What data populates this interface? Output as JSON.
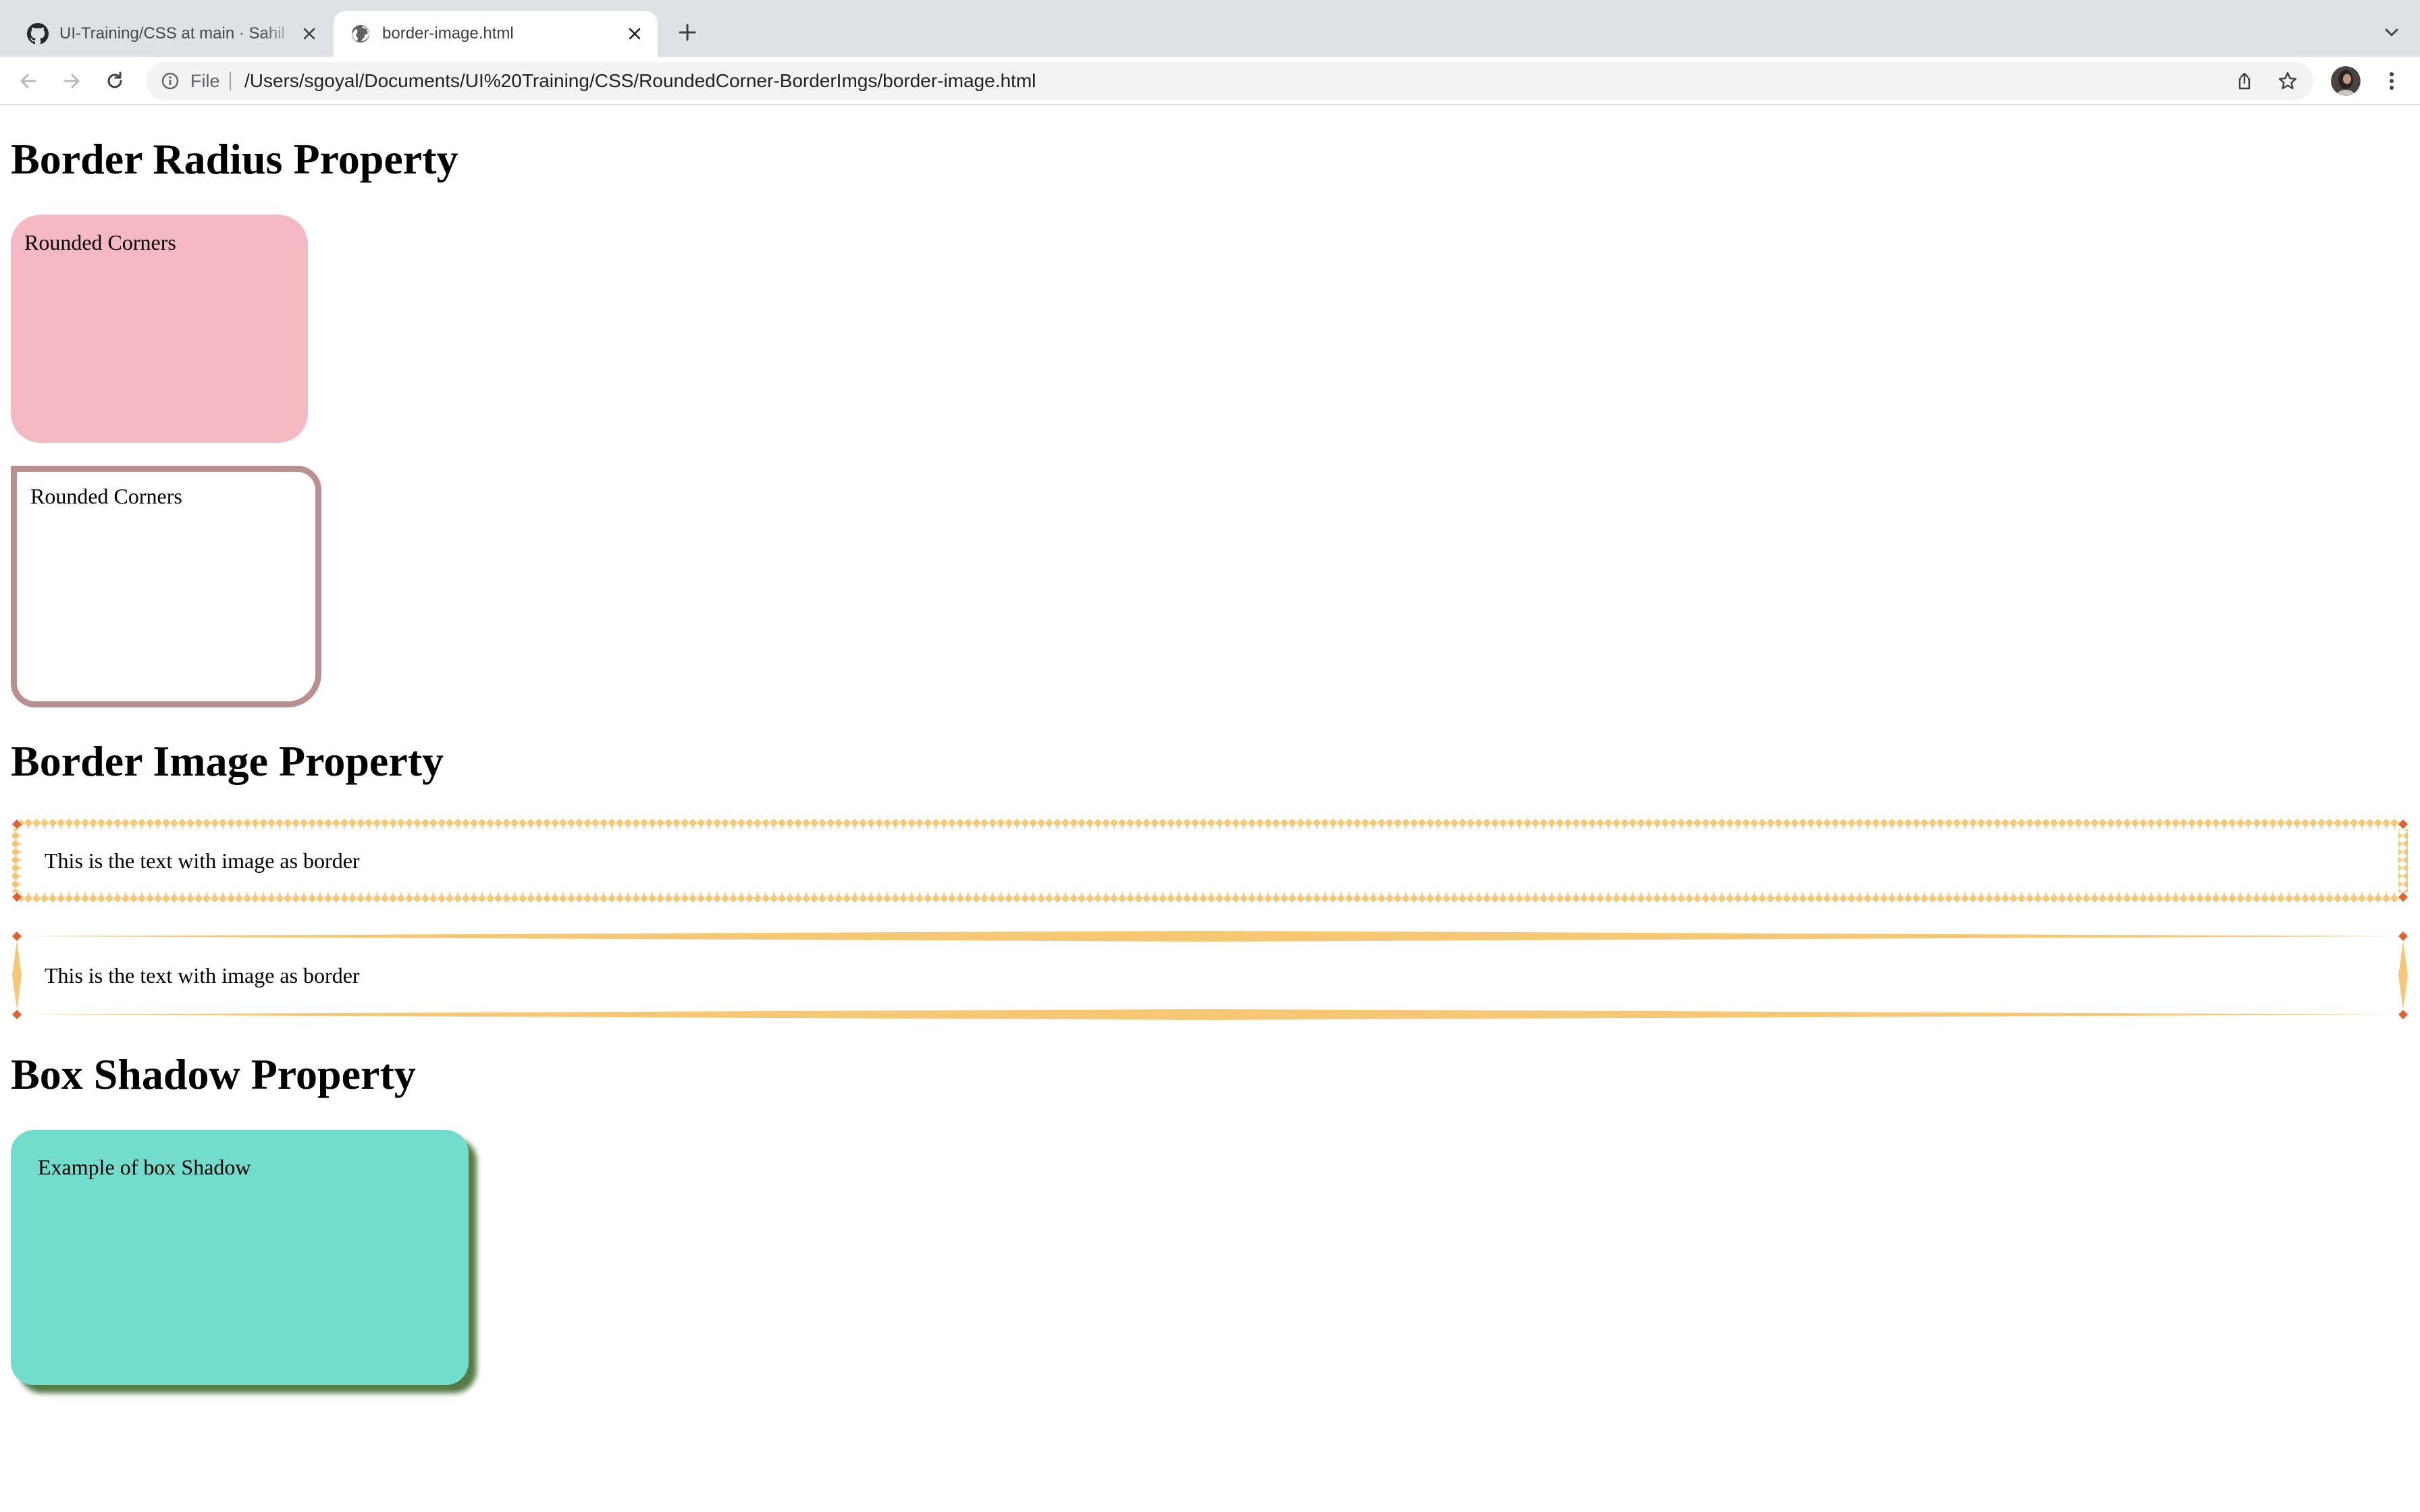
{
  "browser": {
    "tabs": [
      {
        "title": "UI-Training/CSS at main · Sahil",
        "icon": "github-icon",
        "active": false
      },
      {
        "title": "border-image.html",
        "icon": "globe-icon",
        "active": true
      }
    ],
    "new_tab_icon": "plus-icon",
    "tab_search_icon": "chevron-down-icon",
    "toolbar": {
      "back_icon": "arrow-left-icon",
      "forward_icon": "arrow-right-icon",
      "reload_icon": "reload-icon",
      "scheme_label": "File",
      "url": "/Users/sgoyal/Documents/UI%20Training/CSS/RoundedCorner-BorderImgs/border-image.html",
      "share_icon": "share-icon",
      "bookmark_icon": "star-icon",
      "menu_icon": "kebab-menu-icon"
    }
  },
  "page": {
    "sections": {
      "border_radius": {
        "heading": "Border Radius Property",
        "box1_text": "Rounded Corners",
        "box2_text": "Rounded Corners"
      },
      "border_image": {
        "heading": "Border Image Property",
        "box1_text": "This is the text with image as border",
        "box2_text": "This is the text with image as border"
      },
      "box_shadow": {
        "heading": "Box Shadow Property",
        "box_text": "Example of box Shadow"
      }
    },
    "colors": {
      "pink_box": "#f4b9c3",
      "outline_border": "#b89090",
      "border_image_diamond": "#f6c774",
      "border_image_corner": "#e2622f",
      "shadow_box_bg": "#72ddcc",
      "shadow_color": "#557a43"
    }
  }
}
